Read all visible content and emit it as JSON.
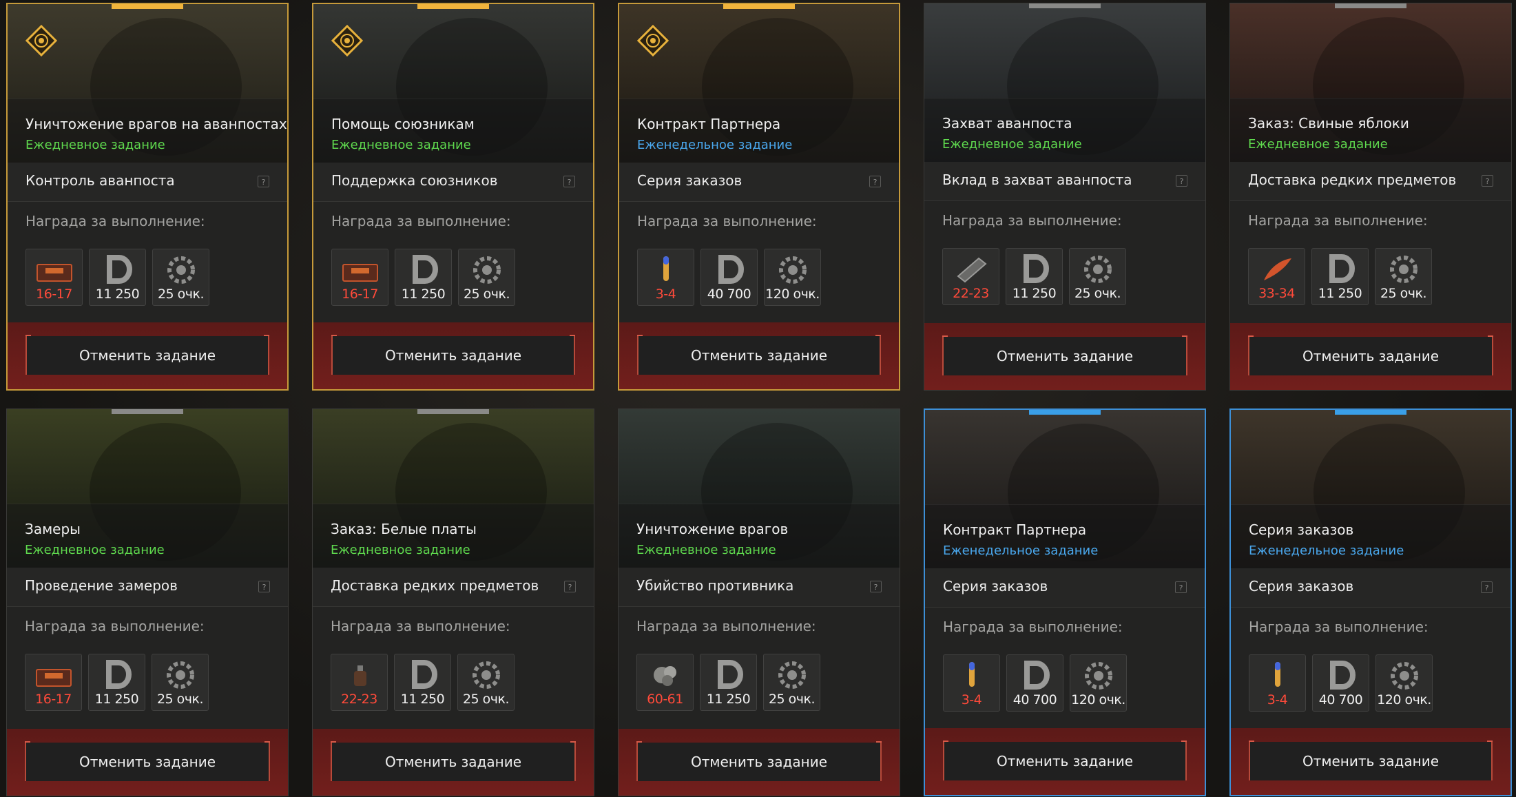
{
  "quest_cards": [
    {
      "title": "Уничтожение врагов на аванпостах",
      "type": "Ежедневное задание",
      "type_kind": "daily",
      "objective": "Контроль аванпоста",
      "help": "?",
      "reward_label": "Награда за выполнение:",
      "rewards": [
        {
          "icon": "crate-icon",
          "value": "16-17",
          "highlight": true
        },
        {
          "icon": "currency-d-icon",
          "value": "11 250",
          "highlight": false
        },
        {
          "icon": "gear-points-icon",
          "value": "25 очк.",
          "highlight": false
        }
      ],
      "cancel_label": "Отменить задание",
      "frame": "gold",
      "emblem": true
    },
    {
      "title": "Помощь союзникам",
      "type": "Ежедневное задание",
      "type_kind": "daily",
      "objective": "Поддержка союзников",
      "help": "?",
      "reward_label": "Награда за выполнение:",
      "rewards": [
        {
          "icon": "crate-icon",
          "value": "16-17",
          "highlight": true
        },
        {
          "icon": "currency-d-icon",
          "value": "11 250",
          "highlight": false
        },
        {
          "icon": "gear-points-icon",
          "value": "25 очк.",
          "highlight": false
        }
      ],
      "cancel_label": "Отменить задание",
      "frame": "gold",
      "emblem": true
    },
    {
      "title": "Контракт Партнера",
      "type": "Еженедельное задание",
      "type_kind": "weekly",
      "objective": "Серия заказов",
      "help": "?",
      "reward_label": "Награда за выполнение:",
      "rewards": [
        {
          "icon": "bullet-icon",
          "value": "3-4",
          "highlight": true
        },
        {
          "icon": "currency-d-icon",
          "value": "40 700",
          "highlight": false
        },
        {
          "icon": "gear-points-icon",
          "value": "120 очк.",
          "highlight": false
        }
      ],
      "cancel_label": "Отменить задание",
      "frame": "gold",
      "emblem": true
    },
    {
      "title": "Захват аванпоста",
      "type": "Ежедневное задание",
      "type_kind": "daily",
      "objective": "Вклад в захват аванпоста",
      "help": "?",
      "reward_label": "Награда за выполнение:",
      "rewards": [
        {
          "icon": "ammo-box-icon",
          "value": "22-23",
          "highlight": true
        },
        {
          "icon": "currency-d-icon",
          "value": "11 250",
          "highlight": false
        },
        {
          "icon": "gear-points-icon",
          "value": "25 очк.",
          "highlight": false
        }
      ],
      "cancel_label": "Отменить задание",
      "frame": "gray",
      "emblem": false
    },
    {
      "title": "Заказ: Свиные яблоки",
      "type": "Ежедневное задание",
      "type_kind": "daily",
      "objective": "Доставка редких предметов",
      "help": "?",
      "reward_label": "Награда за выполнение:",
      "rewards": [
        {
          "icon": "feather-icon",
          "value": "33-34",
          "highlight": true
        },
        {
          "icon": "currency-d-icon",
          "value": "11 250",
          "highlight": false
        },
        {
          "icon": "gear-points-icon",
          "value": "25 очк.",
          "highlight": false
        }
      ],
      "cancel_label": "Отменить задание",
      "frame": "gray",
      "emblem": false
    },
    {
      "title": "Замеры",
      "type": "Ежедневное задание",
      "type_kind": "daily",
      "objective": "Проведение замеров",
      "help": "?",
      "reward_label": "Награда за выполнение:",
      "rewards": [
        {
          "icon": "crate-icon",
          "value": "16-17",
          "highlight": true
        },
        {
          "icon": "currency-d-icon",
          "value": "11 250",
          "highlight": false
        },
        {
          "icon": "gear-points-icon",
          "value": "25 очк.",
          "highlight": false
        }
      ],
      "cancel_label": "Отменить задание",
      "frame": "gray",
      "emblem": false
    },
    {
      "title": "Заказ: Белые платы",
      "type": "Ежедневное задание",
      "type_kind": "daily",
      "objective": "Доставка редких предметов",
      "help": "?",
      "reward_label": "Награда за выполнение:",
      "rewards": [
        {
          "icon": "grenade-icon",
          "value": "22-23",
          "highlight": true
        },
        {
          "icon": "currency-d-icon",
          "value": "11 250",
          "highlight": false
        },
        {
          "icon": "gear-points-icon",
          "value": "25 очк.",
          "highlight": false
        }
      ],
      "cancel_label": "Отменить задание",
      "frame": "gray",
      "emblem": false
    },
    {
      "title": "Уничтожение врагов",
      "type": "Ежедневное задание",
      "type_kind": "daily",
      "objective": "Убийство противника",
      "help": "?",
      "reward_label": "Награда за выполнение:",
      "rewards": [
        {
          "icon": "ore-icon",
          "value": "60-61",
          "highlight": true
        },
        {
          "icon": "currency-d-icon",
          "value": "11 250",
          "highlight": false
        },
        {
          "icon": "gear-points-icon",
          "value": "25 очк.",
          "highlight": false
        }
      ],
      "cancel_label": "Отменить задание",
      "frame": "none",
      "emblem": false
    },
    {
      "title": "Контракт Партнера",
      "type": "Еженедельное задание",
      "type_kind": "weekly",
      "objective": "Серия заказов",
      "help": "?",
      "reward_label": "Награда за выполнение:",
      "rewards": [
        {
          "icon": "bullet-icon",
          "value": "3-4",
          "highlight": true
        },
        {
          "icon": "currency-d-icon",
          "value": "40 700",
          "highlight": false
        },
        {
          "icon": "gear-points-icon",
          "value": "120 очк.",
          "highlight": false
        }
      ],
      "cancel_label": "Отменить задание",
      "frame": "blue",
      "emblem": false
    },
    {
      "title": "Серия заказов",
      "type": "Еженедельное задание",
      "type_kind": "weekly",
      "objective": "Серия заказов",
      "help": "?",
      "reward_label": "Награда за выполнение:",
      "rewards": [
        {
          "icon": "bullet-icon",
          "value": "3-4",
          "highlight": true
        },
        {
          "icon": "currency-d-icon",
          "value": "40 700",
          "highlight": false
        },
        {
          "icon": "gear-points-icon",
          "value": "120 очк.",
          "highlight": false
        }
      ],
      "cancel_label": "Отменить задание",
      "frame": "blue",
      "emblem": false
    }
  ],
  "colors": {
    "gold_frame": "#c69a3a",
    "blue_frame": "#3d8fd6",
    "daily_text": "#5fd94e",
    "weekly_text": "#4aa8ee",
    "reward_highlight": "#ff4a3a",
    "footer_red": "#6a1e1c"
  }
}
